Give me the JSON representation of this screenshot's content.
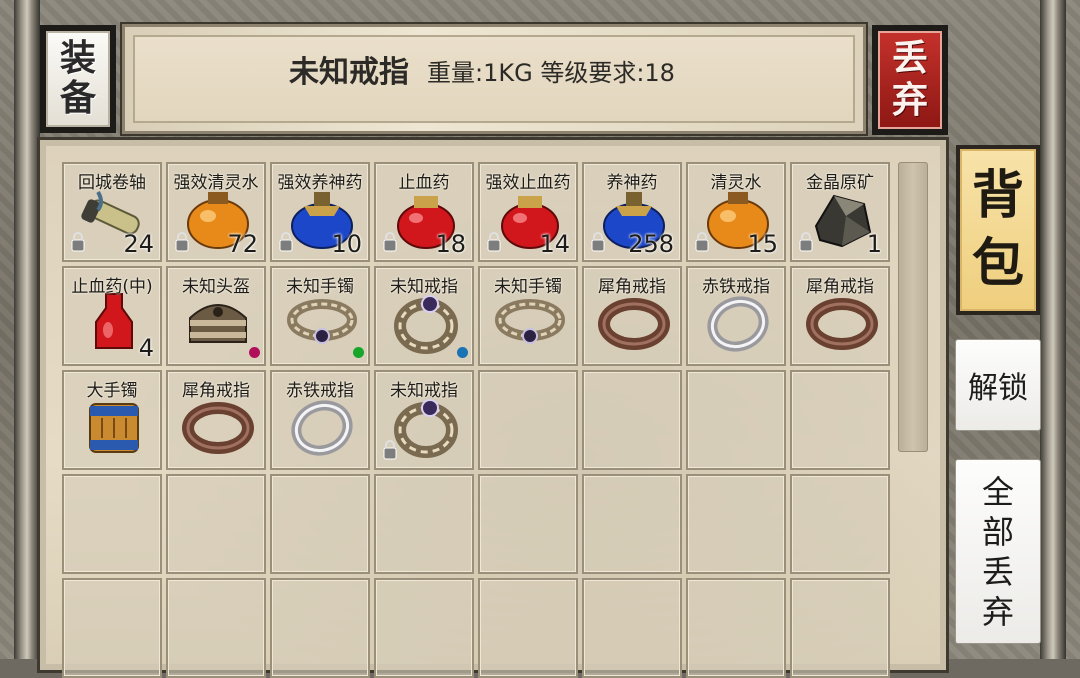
{
  "equip_button": {
    "chars": [
      "装",
      "备"
    ]
  },
  "info_banner": {
    "item_name": "未知戒指",
    "meta": "重量:1KG 等级要求:18"
  },
  "discard_button": {
    "chars": [
      "丢",
      "弃"
    ]
  },
  "bag_tab": {
    "chars": [
      "背",
      "包"
    ]
  },
  "unlock_button": {
    "label": "解锁"
  },
  "discard_all_button": {
    "chars": [
      "全",
      "部",
      "丢",
      "弃"
    ]
  },
  "colors": {
    "discard_red": "#a82420",
    "bag_tab_gold": "#f2d68a",
    "marker_magenta": "#b0105a",
    "marker_green": "#17a52a",
    "marker_blue": "#1a73b5"
  },
  "inventory": {
    "slots": [
      {
        "name": "回城卷轴",
        "count": "24",
        "icon": "scroll-icon",
        "bound": true
      },
      {
        "name": "强效清灵水",
        "count": "72",
        "icon": "orange-potion-icon",
        "bound": true
      },
      {
        "name": "强效养神药",
        "count": "10",
        "icon": "blue-potion-icon",
        "bound": true
      },
      {
        "name": "止血药",
        "count": "18",
        "icon": "red-potion-icon",
        "bound": true
      },
      {
        "name": "强效止血药",
        "count": "14",
        "icon": "red-potion-icon",
        "bound": true
      },
      {
        "name": "养神药",
        "count": "258",
        "icon": "blue-potion-icon",
        "bound": true
      },
      {
        "name": "清灵水",
        "count": "15",
        "icon": "orange-potion-icon",
        "bound": true
      },
      {
        "name": "金晶原矿",
        "count": "1",
        "icon": "ore-icon",
        "bound": true
      },
      {
        "name": "止血药(中)",
        "count": "4",
        "icon": "red-bottle-icon",
        "bound": false
      },
      {
        "name": "未知头盔",
        "count": "",
        "icon": "helmet-icon",
        "bound": false,
        "marker": "magenta"
      },
      {
        "name": "未知手镯",
        "count": "",
        "icon": "bracelet-icon",
        "bound": false,
        "marker": "green"
      },
      {
        "name": "未知戒指",
        "count": "",
        "icon": "unknown-ring-icon",
        "bound": false,
        "marker": "blue"
      },
      {
        "name": "未知手镯",
        "count": "",
        "icon": "bracelet-icon",
        "bound": false
      },
      {
        "name": "犀角戒指",
        "count": "",
        "icon": "horn-ring-icon",
        "bound": false
      },
      {
        "name": "赤铁戒指",
        "count": "",
        "icon": "silver-ring-icon",
        "bound": false
      },
      {
        "name": "犀角戒指",
        "count": "",
        "icon": "horn-ring-icon",
        "bound": false
      },
      {
        "name": "大手镯",
        "count": "",
        "icon": "big-bracelet-icon",
        "bound": false
      },
      {
        "name": "犀角戒指",
        "count": "",
        "icon": "horn-ring-icon",
        "bound": false
      },
      {
        "name": "赤铁戒指",
        "count": "",
        "icon": "silver-ring-icon",
        "bound": false
      },
      {
        "name": "未知戒指",
        "count": "",
        "icon": "unknown-ring-icon",
        "bound": true
      },
      {
        "name": "",
        "count": "",
        "icon": "",
        "bound": false
      },
      {
        "name": "",
        "count": "",
        "icon": "",
        "bound": false
      },
      {
        "name": "",
        "count": "",
        "icon": "",
        "bound": false
      },
      {
        "name": "",
        "count": "",
        "icon": "",
        "bound": false
      },
      {
        "name": "",
        "count": "",
        "icon": "",
        "bound": false
      },
      {
        "name": "",
        "count": "",
        "icon": "",
        "bound": false
      },
      {
        "name": "",
        "count": "",
        "icon": "",
        "bound": false
      },
      {
        "name": "",
        "count": "",
        "icon": "",
        "bound": false
      },
      {
        "name": "",
        "count": "",
        "icon": "",
        "bound": false
      },
      {
        "name": "",
        "count": "",
        "icon": "",
        "bound": false
      },
      {
        "name": "",
        "count": "",
        "icon": "",
        "bound": false
      },
      {
        "name": "",
        "count": "",
        "icon": "",
        "bound": false
      },
      {
        "name": "",
        "count": "",
        "icon": "",
        "bound": false
      },
      {
        "name": "",
        "count": "",
        "icon": "",
        "bound": false
      },
      {
        "name": "",
        "count": "",
        "icon": "",
        "bound": false
      },
      {
        "name": "",
        "count": "",
        "icon": "",
        "bound": false
      },
      {
        "name": "",
        "count": "",
        "icon": "",
        "bound": false
      },
      {
        "name": "",
        "count": "",
        "icon": "",
        "bound": false
      },
      {
        "name": "",
        "count": "",
        "icon": "",
        "bound": false
      },
      {
        "name": "",
        "count": "",
        "icon": "",
        "bound": false
      }
    ]
  }
}
